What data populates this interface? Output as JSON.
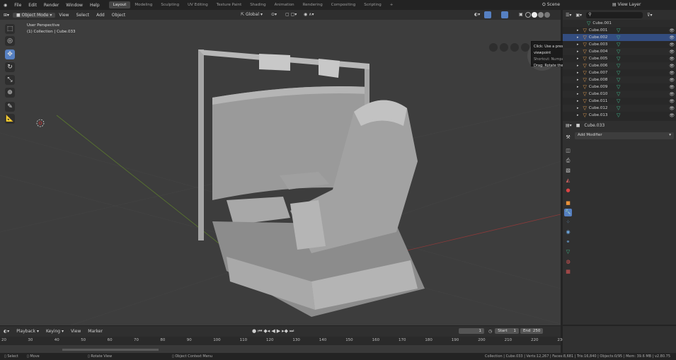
{
  "menu": [
    "File",
    "Edit",
    "Render",
    "Window",
    "Help"
  ],
  "workspaces": [
    "Layout",
    "Modeling",
    "Sculpting",
    "UV Editing",
    "Texture Paint",
    "Shading",
    "Animation",
    "Rendering",
    "Compositing",
    "Scripting"
  ],
  "active_workspace": "Layout",
  "scene": "Scene",
  "view_layer": "View Layer",
  "header": {
    "mode": "Object Mode",
    "items": [
      "View",
      "Select",
      "Add",
      "Object"
    ],
    "orientation": "Global"
  },
  "viewport": {
    "title": "User Perspective",
    "subtitle": "(1) Collection | Cube.033"
  },
  "tooltip": {
    "line1": "Click: Use a preset viewpoint",
    "line2": "Shortcut: Numpad 1",
    "line3": "Drag: Rotate the view"
  },
  "gizmo": {
    "z": "Z",
    "y": "Y",
    "x_color": "#e0344b",
    "y_color": "#7cc326",
    "z_color": "#2f87e0"
  },
  "outliner": {
    "items": [
      "Cube.001",
      "Cube.001",
      "Cube.002",
      "Cube.003",
      "Cube.004",
      "Cube.005",
      "Cube.006",
      "Cube.007",
      "Cube.008",
      "Cube.009",
      "Cube.010",
      "Cube.011",
      "Cube.012",
      "Cube.013"
    ],
    "selected": "Cube.002"
  },
  "properties": {
    "object": "Cube.033",
    "add_modifier": "Add Modifier"
  },
  "timeline": {
    "menu": [
      "Playback",
      "Keying",
      "View",
      "Marker"
    ],
    "current_frame": "1",
    "start_label": "Start",
    "start": "1",
    "end_label": "End",
    "end": "250",
    "ticks": [
      "20",
      "30",
      "40",
      "50",
      "60",
      "70",
      "80",
      "90",
      "100",
      "110",
      "120",
      "130",
      "140",
      "150",
      "160",
      "170",
      "180",
      "190",
      "200",
      "210",
      "220",
      "230"
    ]
  },
  "status": {
    "select": "Select",
    "move": "Move",
    "rotate": "Rotate View",
    "context": "Object Context Menu",
    "info": "Collection | Cube.033 | Verts:12,267 | Faces:8,681 | Tris:16,840 | Objects:0/95 | Mem: 39.6 MB | v2.80.75"
  },
  "accent": "#5680c2"
}
